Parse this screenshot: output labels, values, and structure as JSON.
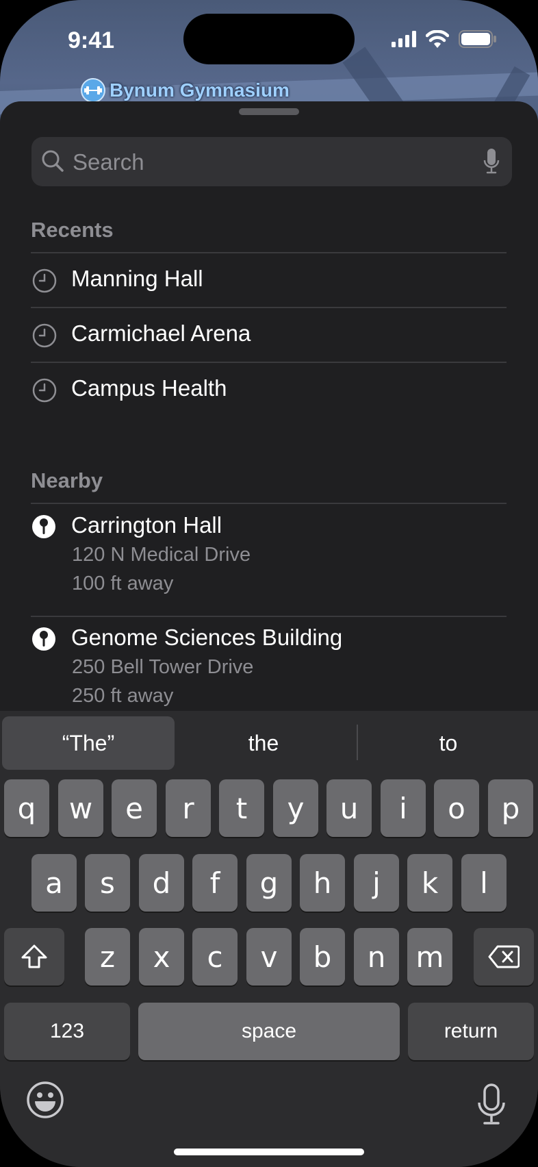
{
  "status": {
    "time": "9:41"
  },
  "map": {
    "label": "Bynum Gymnasium",
    "label_icon": "dumbbell-icon"
  },
  "search": {
    "placeholder": "Search"
  },
  "recents": {
    "title": "Recents",
    "items": [
      {
        "label": "Manning Hall"
      },
      {
        "label": "Carmichael Arena"
      },
      {
        "label": "Campus Health"
      }
    ]
  },
  "nearby": {
    "title": "Nearby",
    "items": [
      {
        "name": "Carrington Hall",
        "address": "120 N Medical Drive",
        "distance": "100 ft away"
      },
      {
        "name": "Genome Sciences Building",
        "address": "250 Bell Tower Drive",
        "distance": "250 ft away"
      }
    ]
  },
  "keyboard": {
    "suggestions": [
      "“The”",
      "the",
      "to"
    ],
    "row1": [
      "q",
      "w",
      "e",
      "r",
      "t",
      "y",
      "u",
      "i",
      "o",
      "p"
    ],
    "row2": [
      "a",
      "s",
      "d",
      "f",
      "g",
      "h",
      "j",
      "k",
      "l"
    ],
    "row3": [
      "z",
      "x",
      "c",
      "v",
      "b",
      "n",
      "m"
    ],
    "numbers_label": "123",
    "space_label": "space",
    "return_label": "return"
  },
  "colors": {
    "sheet": "#1f1f21",
    "keyboard": "#2c2c2e",
    "key": "#6b6b6e",
    "accent_map_label": "#9fd0ff"
  }
}
